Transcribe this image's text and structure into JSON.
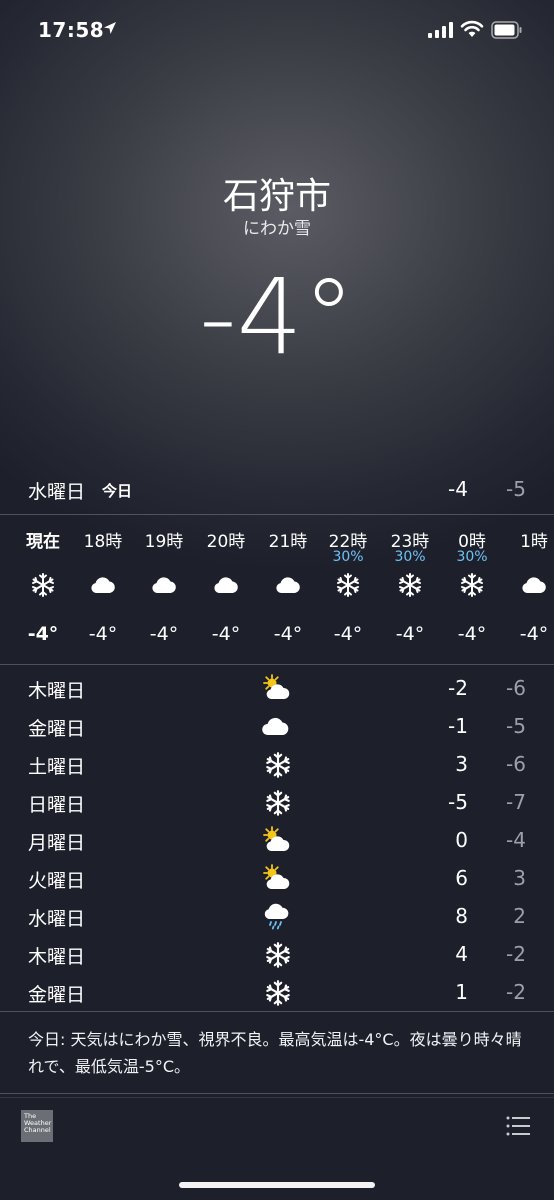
{
  "status_bar": {
    "time": "17:58"
  },
  "header": {
    "city": "石狩市",
    "condition": "にわか雪",
    "temperature": "-4°"
  },
  "today": {
    "day": "水曜日",
    "label": "今日",
    "high": "-4",
    "low": "-5"
  },
  "hourly": [
    {
      "time": "現在",
      "prob": "",
      "icon": "snow-icon",
      "temp": "-4°",
      "bold": true
    },
    {
      "time": "18時",
      "prob": "",
      "icon": "cloud-icon",
      "temp": "-4°"
    },
    {
      "time": "19時",
      "prob": "",
      "icon": "cloud-icon",
      "temp": "-4°"
    },
    {
      "time": "20時",
      "prob": "",
      "icon": "cloud-icon",
      "temp": "-4°"
    },
    {
      "time": "21時",
      "prob": "",
      "icon": "cloud-icon",
      "temp": "-4°"
    },
    {
      "time": "22時",
      "prob": "30%",
      "icon": "snow-icon",
      "temp": "-4°"
    },
    {
      "time": "23時",
      "prob": "30%",
      "icon": "snow-icon",
      "temp": "-4°"
    },
    {
      "time": "0時",
      "prob": "30%",
      "icon": "snow-icon",
      "temp": "-4°"
    },
    {
      "time": "1時",
      "prob": "",
      "icon": "cloud-icon",
      "temp": "-4°"
    }
  ],
  "daily": [
    {
      "day": "木曜日",
      "icon": "partly-sunny-icon",
      "high": "-2",
      "low": "-6"
    },
    {
      "day": "金曜日",
      "icon": "cloud-icon",
      "high": "-1",
      "low": "-5"
    },
    {
      "day": "土曜日",
      "icon": "snow-icon",
      "high": "3",
      "low": "-6"
    },
    {
      "day": "日曜日",
      "icon": "snow-icon",
      "high": "-5",
      "low": "-7"
    },
    {
      "day": "月曜日",
      "icon": "partly-sunny-icon",
      "high": "0",
      "low": "-4"
    },
    {
      "day": "火曜日",
      "icon": "partly-sunny-icon",
      "high": "6",
      "low": "3"
    },
    {
      "day": "水曜日",
      "icon": "rain-cloud-icon",
      "high": "8",
      "low": "2"
    },
    {
      "day": "木曜日",
      "icon": "snow-icon",
      "high": "4",
      "low": "-2"
    },
    {
      "day": "金曜日",
      "icon": "snow-icon",
      "high": "1",
      "low": "-2"
    }
  ],
  "summary": "今日: 天気はにわか雪、視界不良。最高気温は-4°C。夜は曇り時々晴れで、最低気温-5°C。",
  "footer": {
    "logo_text": "The Weather Channel"
  },
  "colors": {
    "probability": "#6ec1f5",
    "low_temp": "#9ea0a7"
  }
}
